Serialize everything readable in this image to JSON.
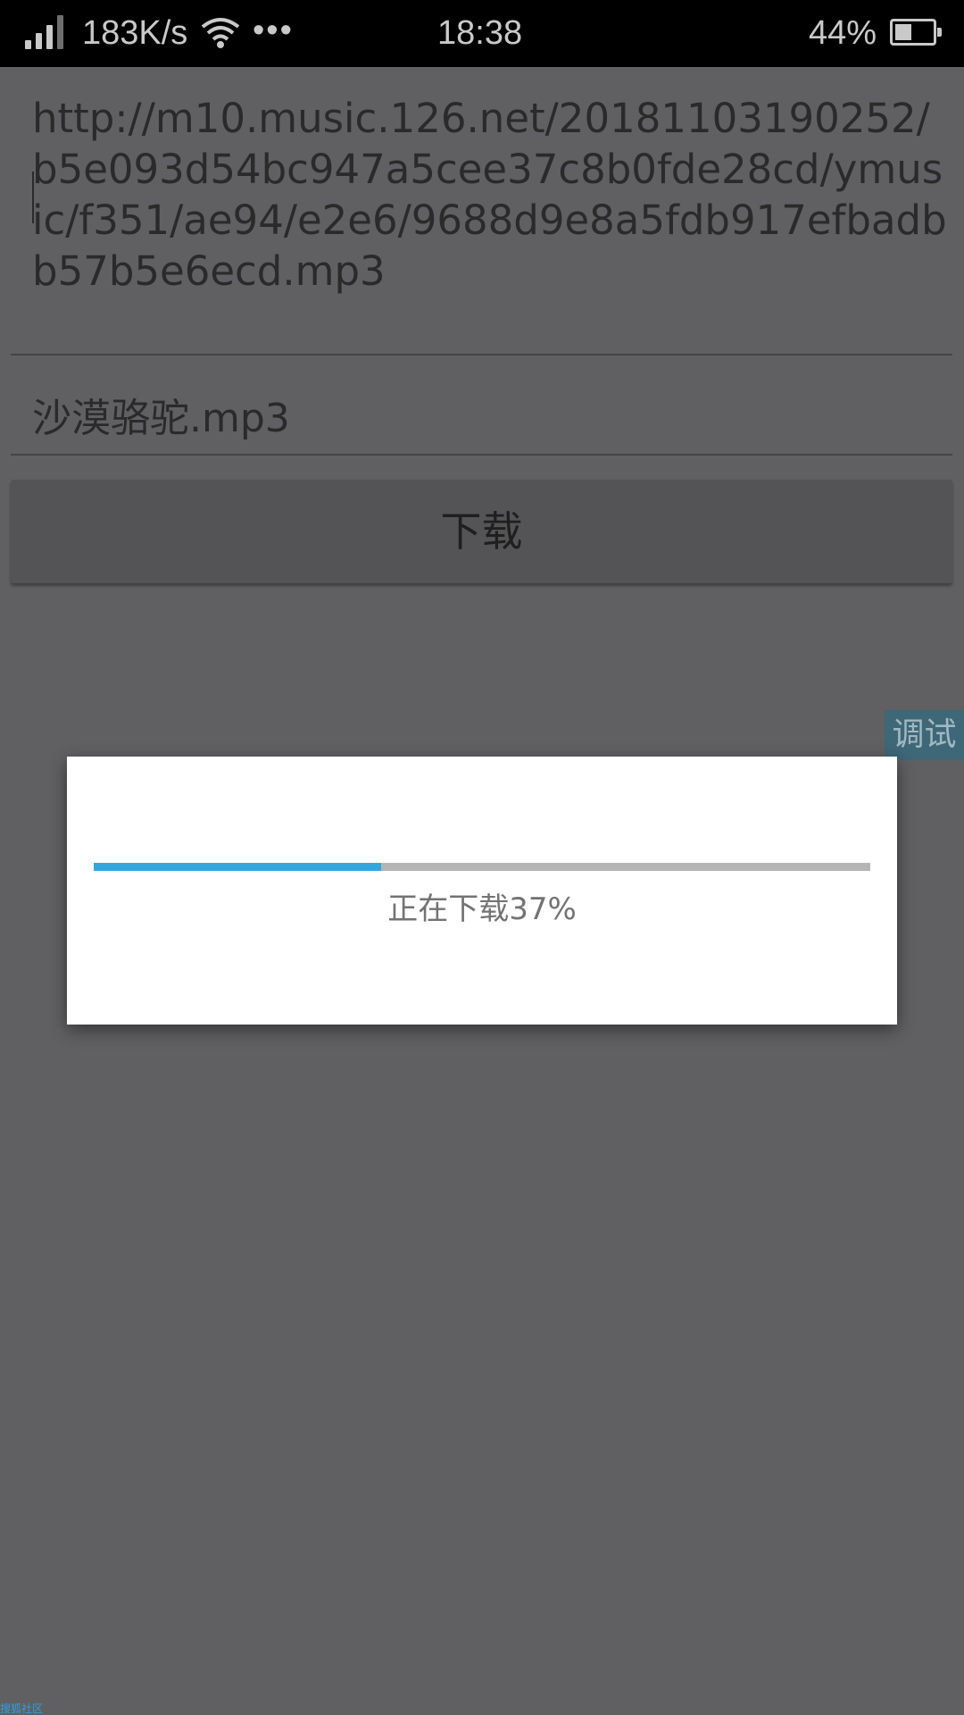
{
  "status_bar": {
    "net_speed": "183K/s",
    "more": "•••",
    "time": "18:38",
    "battery_pct": "44%",
    "icons": [
      "signal-icon",
      "wifi-icon",
      "battery-icon"
    ]
  },
  "form": {
    "url_value": "http://m10.music.126.net/20181103190252/b5e093d54bc947a5cee37c8b0fde28cd/ymusic/f351/ae94/e2e6/9688d9e8a5fdb917efbadbb57b5e6ecd.mp3",
    "filename_value": "沙漠骆驼.mp3",
    "download_label": "下载"
  },
  "debug_tab": {
    "label": "调试"
  },
  "dialog": {
    "progress_percent": 37,
    "progress_text": "正在下载37%",
    "accent_color": "#2fa8e0"
  },
  "watermark": {
    "text": "搜狐社区"
  }
}
